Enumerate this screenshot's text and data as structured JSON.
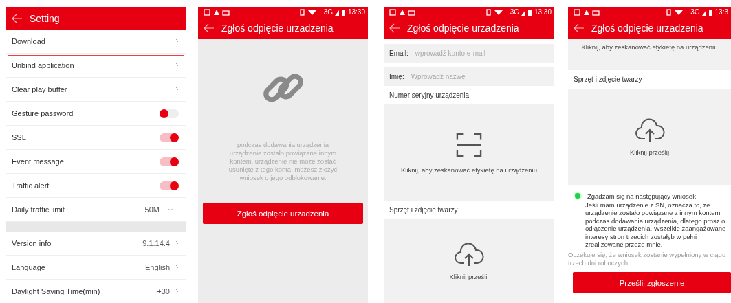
{
  "screens": [
    {
      "kind": "settings",
      "title": "Setting",
      "groups": [
        [
          {
            "kind": "link",
            "label": "Download",
            "highlighted": false
          },
          {
            "kind": "link",
            "label": "Unbind application",
            "highlighted": true
          },
          {
            "kind": "link",
            "label": "Clear play buffer",
            "highlighted": false
          },
          {
            "kind": "toggle",
            "label": "Gesture password",
            "on": false
          },
          {
            "kind": "toggle",
            "label": "SSL",
            "on": true
          },
          {
            "kind": "toggle",
            "label": "Event message",
            "on": true
          },
          {
            "kind": "toggle",
            "label": "Traffic alert",
            "on": true
          },
          {
            "kind": "select",
            "label": "Daily traffic limit",
            "value": "50M"
          }
        ],
        [
          {
            "kind": "link",
            "label": "Version info",
            "value": "9.1.14.4",
            "highlighted": false
          },
          {
            "kind": "link",
            "label": "Language",
            "value": "English",
            "highlighted": false
          },
          {
            "kind": "link",
            "label": "Daylight Saving Time(min)",
            "value": "+30",
            "highlighted": false
          }
        ]
      ]
    },
    {
      "kind": "intro",
      "status": {
        "network": "3G",
        "time": "13:30"
      },
      "title": "Zgłoś odpięcie urzadzenia",
      "message": "podczas dodawania urządzenia urządzenie zostało powiązane innym kontem, urządzenie nie może zostać usunięte z tego konta, możesz złożyć wniosek o jego odblokowanie.",
      "button": "Zgłoś odpięcie urzadzenia"
    },
    {
      "kind": "form",
      "status": {
        "network": "3G",
        "time": "13:30"
      },
      "title": "Zgłoś odpięcie urzadzenia",
      "fields": [
        {
          "label": "Email:",
          "placeholder": "wprowadź konto e-mail"
        },
        {
          "label": "Imię:",
          "placeholder": "Wprowadź nazwę"
        }
      ],
      "serial_label": "Numer seryjny urządzenia",
      "scan_hint": "Kliknij, aby zeskanować etykietę na urządzeniu",
      "photo_label": "Sprzęt i zdjęcie twarzy",
      "upload_hint": "Kliknij prześlij"
    },
    {
      "kind": "submit",
      "status": {
        "network": "3G",
        "time": "13:3"
      },
      "title": "Zgłoś odpięcie urzadzenia",
      "scan_hint": "Kliknij, aby zeskanować etykietę na urządzeniu",
      "photo_label": "Sprzęt i zdjęcie twarzy",
      "upload_hint": "Kliknij prześlij",
      "consent": {
        "label": "Zgadzam się na następujący wniosek",
        "checked": true,
        "text": "Jeśli mam urządzenie z SN, oznacza to, że urządzenie zostało powiązane z innym kontem podczas dodawania urządzenia, dlatego prosz o odłączenie urządzenia. Wszelkie zaangażowane interesy stron trzecich zostałyb w pełni zrealizowane przeze mnie."
      },
      "note": "Oczekuje się, że wniosek zostanie wypełniony w ciągu trzech dni roboczych.",
      "button": "Prześlij zgłoszenie"
    }
  ]
}
